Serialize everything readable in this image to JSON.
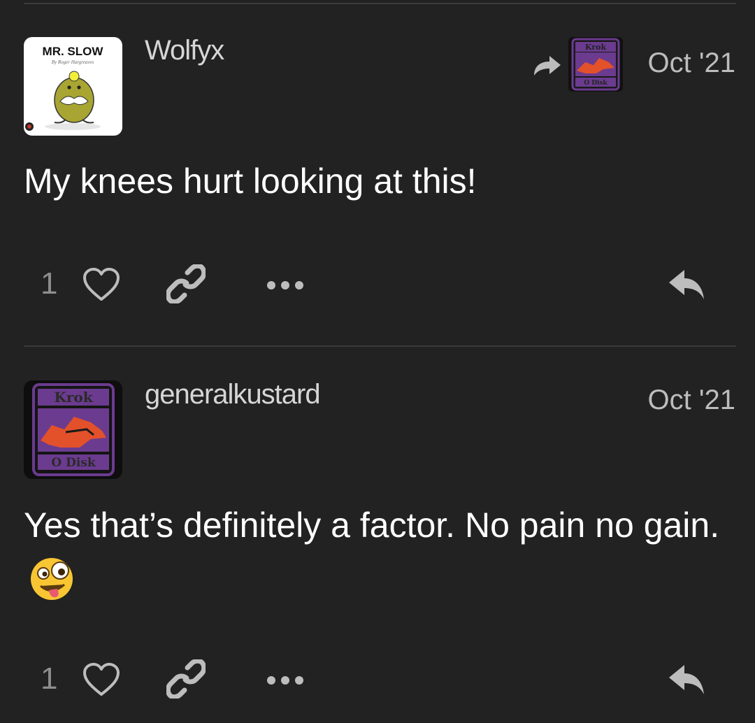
{
  "posts": [
    {
      "username": "Wolfyx",
      "date": "Oct '21",
      "avatar_title": "MR. SLOW",
      "avatar_subtitle": "By Roger Hargreaves",
      "body": "My knees hurt looking at this!",
      "likes": "1",
      "reply_to_avatar": {
        "top_text": "Krok",
        "bottom_text": "O Disk"
      }
    },
    {
      "username": "generalkustard",
      "date": "Oct '21",
      "avatar_top_text": "Krok",
      "avatar_bottom_text": "O Disk",
      "body": "Yes that’s definitely a factor. No pain no gain.",
      "emoji": "zany-face",
      "likes": "1"
    }
  ],
  "colors": {
    "background": "#222222",
    "divider": "#3a3a3a",
    "muted_text": "#8e8e8e",
    "icon": "#bdbdbd",
    "krok_purple": "#6b3b8f",
    "krok_orange": "#e2512a"
  },
  "icons": [
    "share-reply-arrow-icon",
    "heart-icon",
    "link-icon",
    "more-icon",
    "reply-icon"
  ]
}
